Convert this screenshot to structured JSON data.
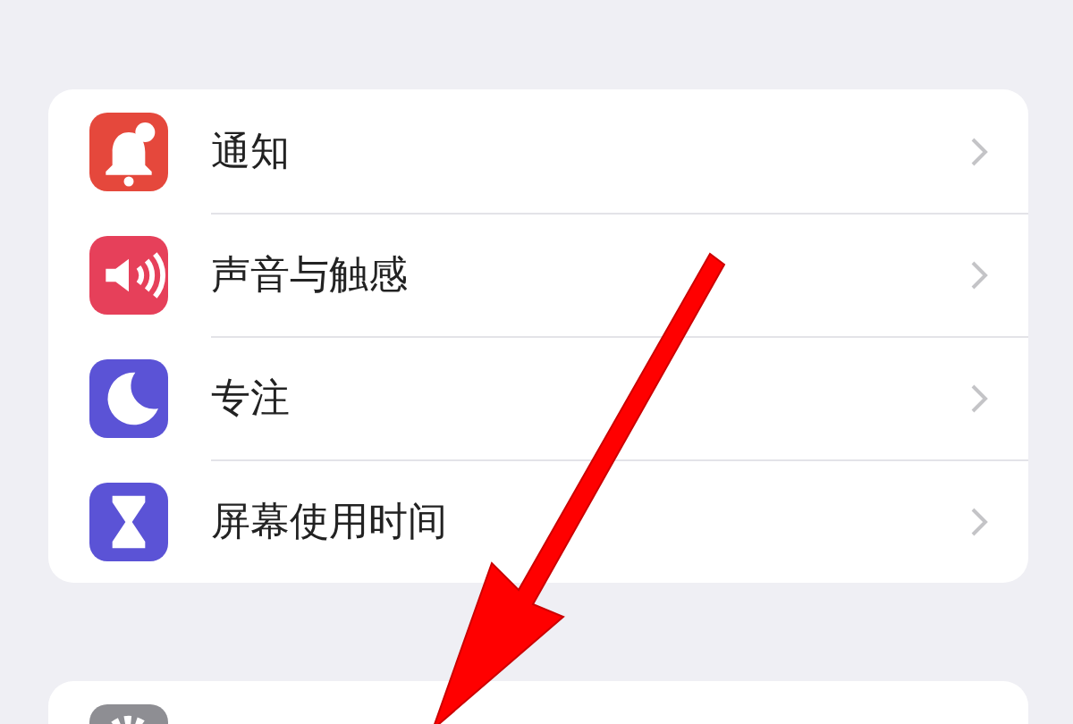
{
  "groups": [
    {
      "items": [
        {
          "label": "通知",
          "color": "#e5483c"
        },
        {
          "label": "声音与触感",
          "color": "#e6405a"
        },
        {
          "label": "专注",
          "color": "#5b53d6"
        },
        {
          "label": "屏幕使用时间",
          "color": "#5b53d6"
        }
      ]
    },
    {
      "items": [
        {
          "color": "#8e8e93"
        }
      ]
    }
  ]
}
